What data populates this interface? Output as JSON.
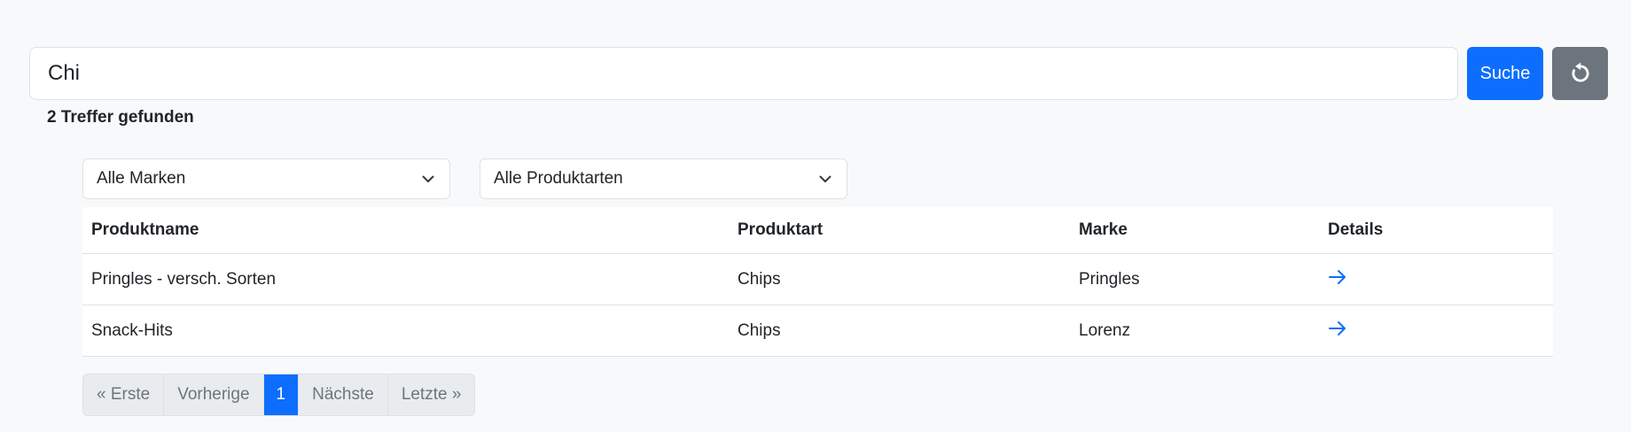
{
  "search": {
    "value": "Chi",
    "button_label": "Suche",
    "reset_icon": "reset-icon"
  },
  "results_summary": "2 Treffer gefunden",
  "filters": {
    "brand": "Alle Marken",
    "product_type": "Alle Produktarten"
  },
  "table": {
    "headers": [
      "Produktname",
      "Produktart",
      "Marke",
      "Details"
    ],
    "rows": [
      [
        "Pringles - versch. Sorten",
        "Chips",
        "Pringles"
      ],
      [
        "Snack-Hits",
        "Chips",
        "Lorenz"
      ]
    ],
    "details_icon": "arrow-right-icon"
  },
  "pagination": {
    "first": "« Erste",
    "prev": "Vorherige",
    "current": "1",
    "next": "Nächste",
    "last": "Letzte »"
  },
  "colors": {
    "primary": "#0d6efd",
    "secondary": "#6c757d",
    "background": "#f8f9fa"
  }
}
